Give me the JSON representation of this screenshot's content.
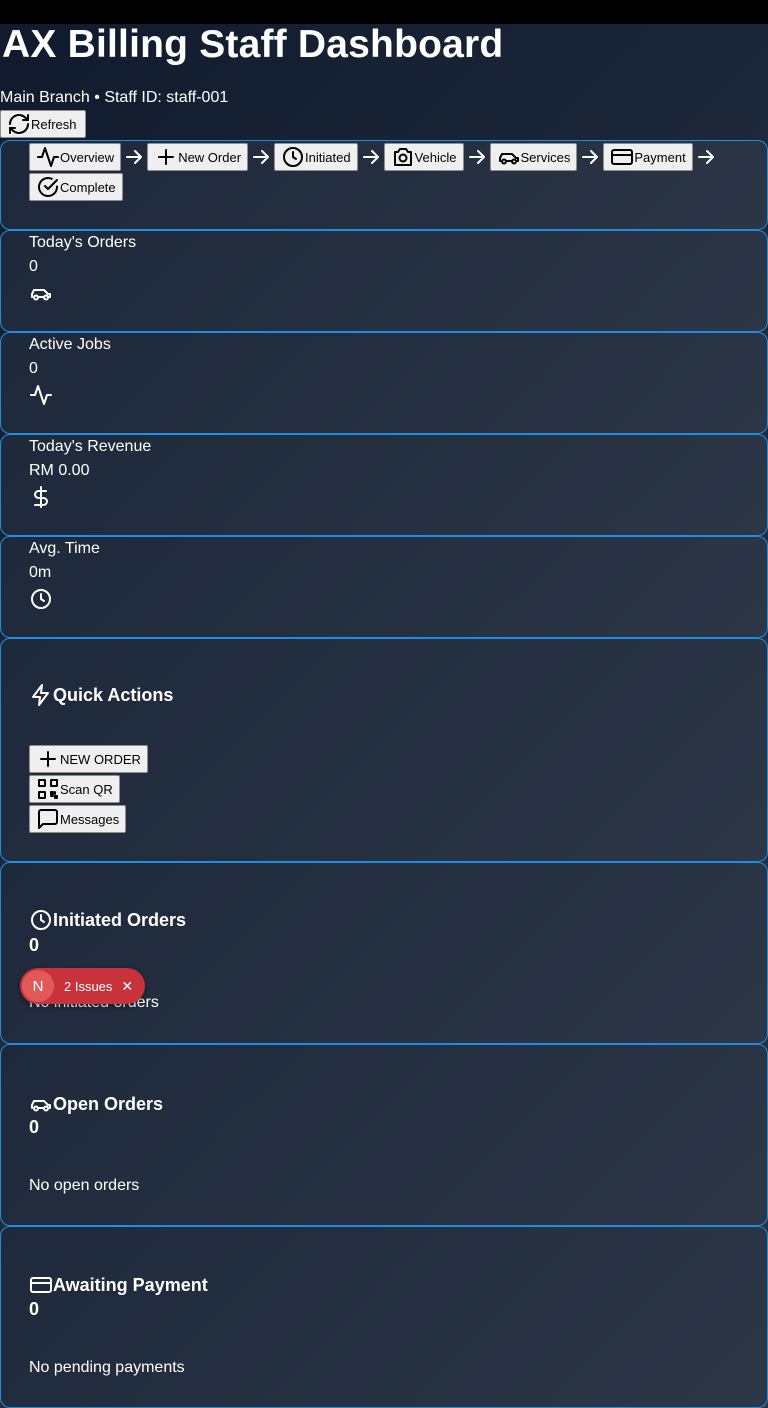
{
  "header": {
    "title": "AX Billing Staff Dashboard",
    "subtitle": "Main Branch • Staff ID: staff-001",
    "refresh_label": "Refresh"
  },
  "steps": [
    "Overview",
    "New Order",
    "Initiated",
    "Vehicle",
    "Services",
    "Payment",
    "Complete"
  ],
  "stats": [
    {
      "label": "Today's Orders",
      "value": "0",
      "icon": "car-icon"
    },
    {
      "label": "Active Jobs",
      "value": "0",
      "icon": "activity-icon"
    },
    {
      "label": "Today's Revenue",
      "value": "RM 0.00",
      "icon": "dollar-icon"
    },
    {
      "label": "Avg. Time",
      "value": "0m",
      "icon": "clock-icon"
    }
  ],
  "quick_actions": {
    "title": "Quick Actions",
    "buttons": [
      "NEW ORDER",
      "Scan QR",
      "Messages"
    ]
  },
  "initiated": {
    "title": "Initiated Orders",
    "count": "0",
    "empty": "No initiated orders"
  },
  "open": {
    "title": "Open Orders",
    "count": "0",
    "empty": "No open orders"
  },
  "awaiting": {
    "title": "Awaiting Payment",
    "count": "0",
    "empty": "No pending payments"
  },
  "toast": {
    "badge": "N",
    "label": "2 Issues",
    "close": "✕"
  },
  "colors": {
    "accent_border": "#1d8fe0",
    "toast": "#c8323a"
  }
}
